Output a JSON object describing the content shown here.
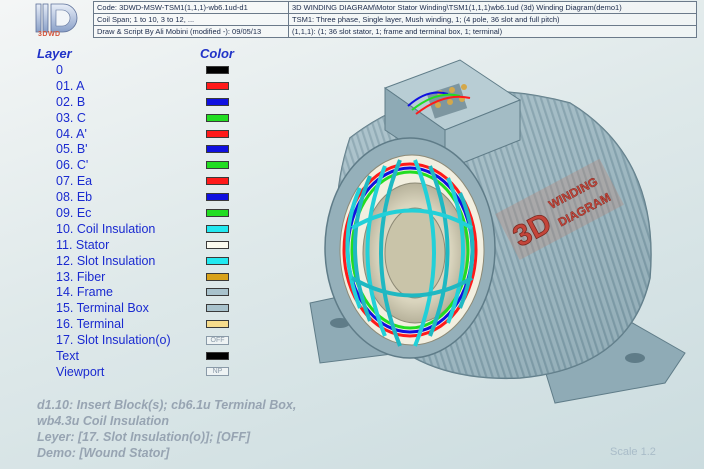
{
  "logo": {
    "caption": "3DWD"
  },
  "info": {
    "row1_left": "Code: 3DWD-MSW-TSM1(1,1,1)-wb6.1ud-d1",
    "row1_right": "3D WINDING DIAGRAM\\Motor Stator Winding\\TSM1(1,1,1)wb6.1ud (3d) Winding Diagram(demo1)",
    "row2_left": "Coil Span; 1 to 10, 3 to 12, ...",
    "row2_right": "TSM1: Three phase, Single layer, Mush winding, 1; (4 pole, 36 slot and full pitch)",
    "row3_left": "Draw & Script By Ali Mobini     (modified -): 09/05/13",
    "row3_right": "(1,1,1): (1; 36 slot stator, 1; frame and terminal box, 1; terminal)"
  },
  "legend": {
    "layer_header": "Layer",
    "color_header": "Color",
    "rows": [
      {
        "label": "0",
        "color": "#000000"
      },
      {
        "label": "01. A",
        "color": "#ff1a1a"
      },
      {
        "label": "02. B",
        "color": "#1010e0"
      },
      {
        "label": "03. C",
        "color": "#22dd22"
      },
      {
        "label": "04. A'",
        "color": "#ff1a1a"
      },
      {
        "label": "05. B'",
        "color": "#1010e0"
      },
      {
        "label": "06. C'",
        "color": "#22dd22"
      },
      {
        "label": "07. Ea",
        "color": "#ff1a1a"
      },
      {
        "label": "08. Eb",
        "color": "#1010e0"
      },
      {
        "label": "09. Ec",
        "color": "#22dd22"
      },
      {
        "label": "10. Coil Insulation",
        "color": "#22e8f0"
      },
      {
        "label": "11. Stator",
        "color": "#fbfbf0"
      },
      {
        "label": "12. Slot Insulation",
        "color": "#22e8f0"
      },
      {
        "label": "13. Fiber",
        "color": "#d9a21a"
      },
      {
        "label": "14. Frame",
        "color": "#a8c2cc"
      },
      {
        "label": "15. Terminal Box",
        "color": "#a8c2cc"
      },
      {
        "label": "16. Terminal",
        "color": "#f7dc8c"
      },
      {
        "label": "17. Slot Insulation(o)",
        "tag": "OFF"
      },
      {
        "label": "Text",
        "color": "#000000"
      },
      {
        "label": "Viewport",
        "tag": "NP"
      }
    ]
  },
  "footer": {
    "line1": "d1.10: Insert Block(s); cb6.1u Terminal Box,",
    "line2": "wb4.3u Coil Insulation",
    "line3": "Leyer: [17. Slot Insulation(o)]; [OFF]",
    "line4": "Demo: [Wound Stator]"
  },
  "scale": "Scale 1.2",
  "motor": {
    "logo_line1": "3D",
    "logo_line2": "WINDING",
    "logo_line3": "DIAGRAM"
  }
}
